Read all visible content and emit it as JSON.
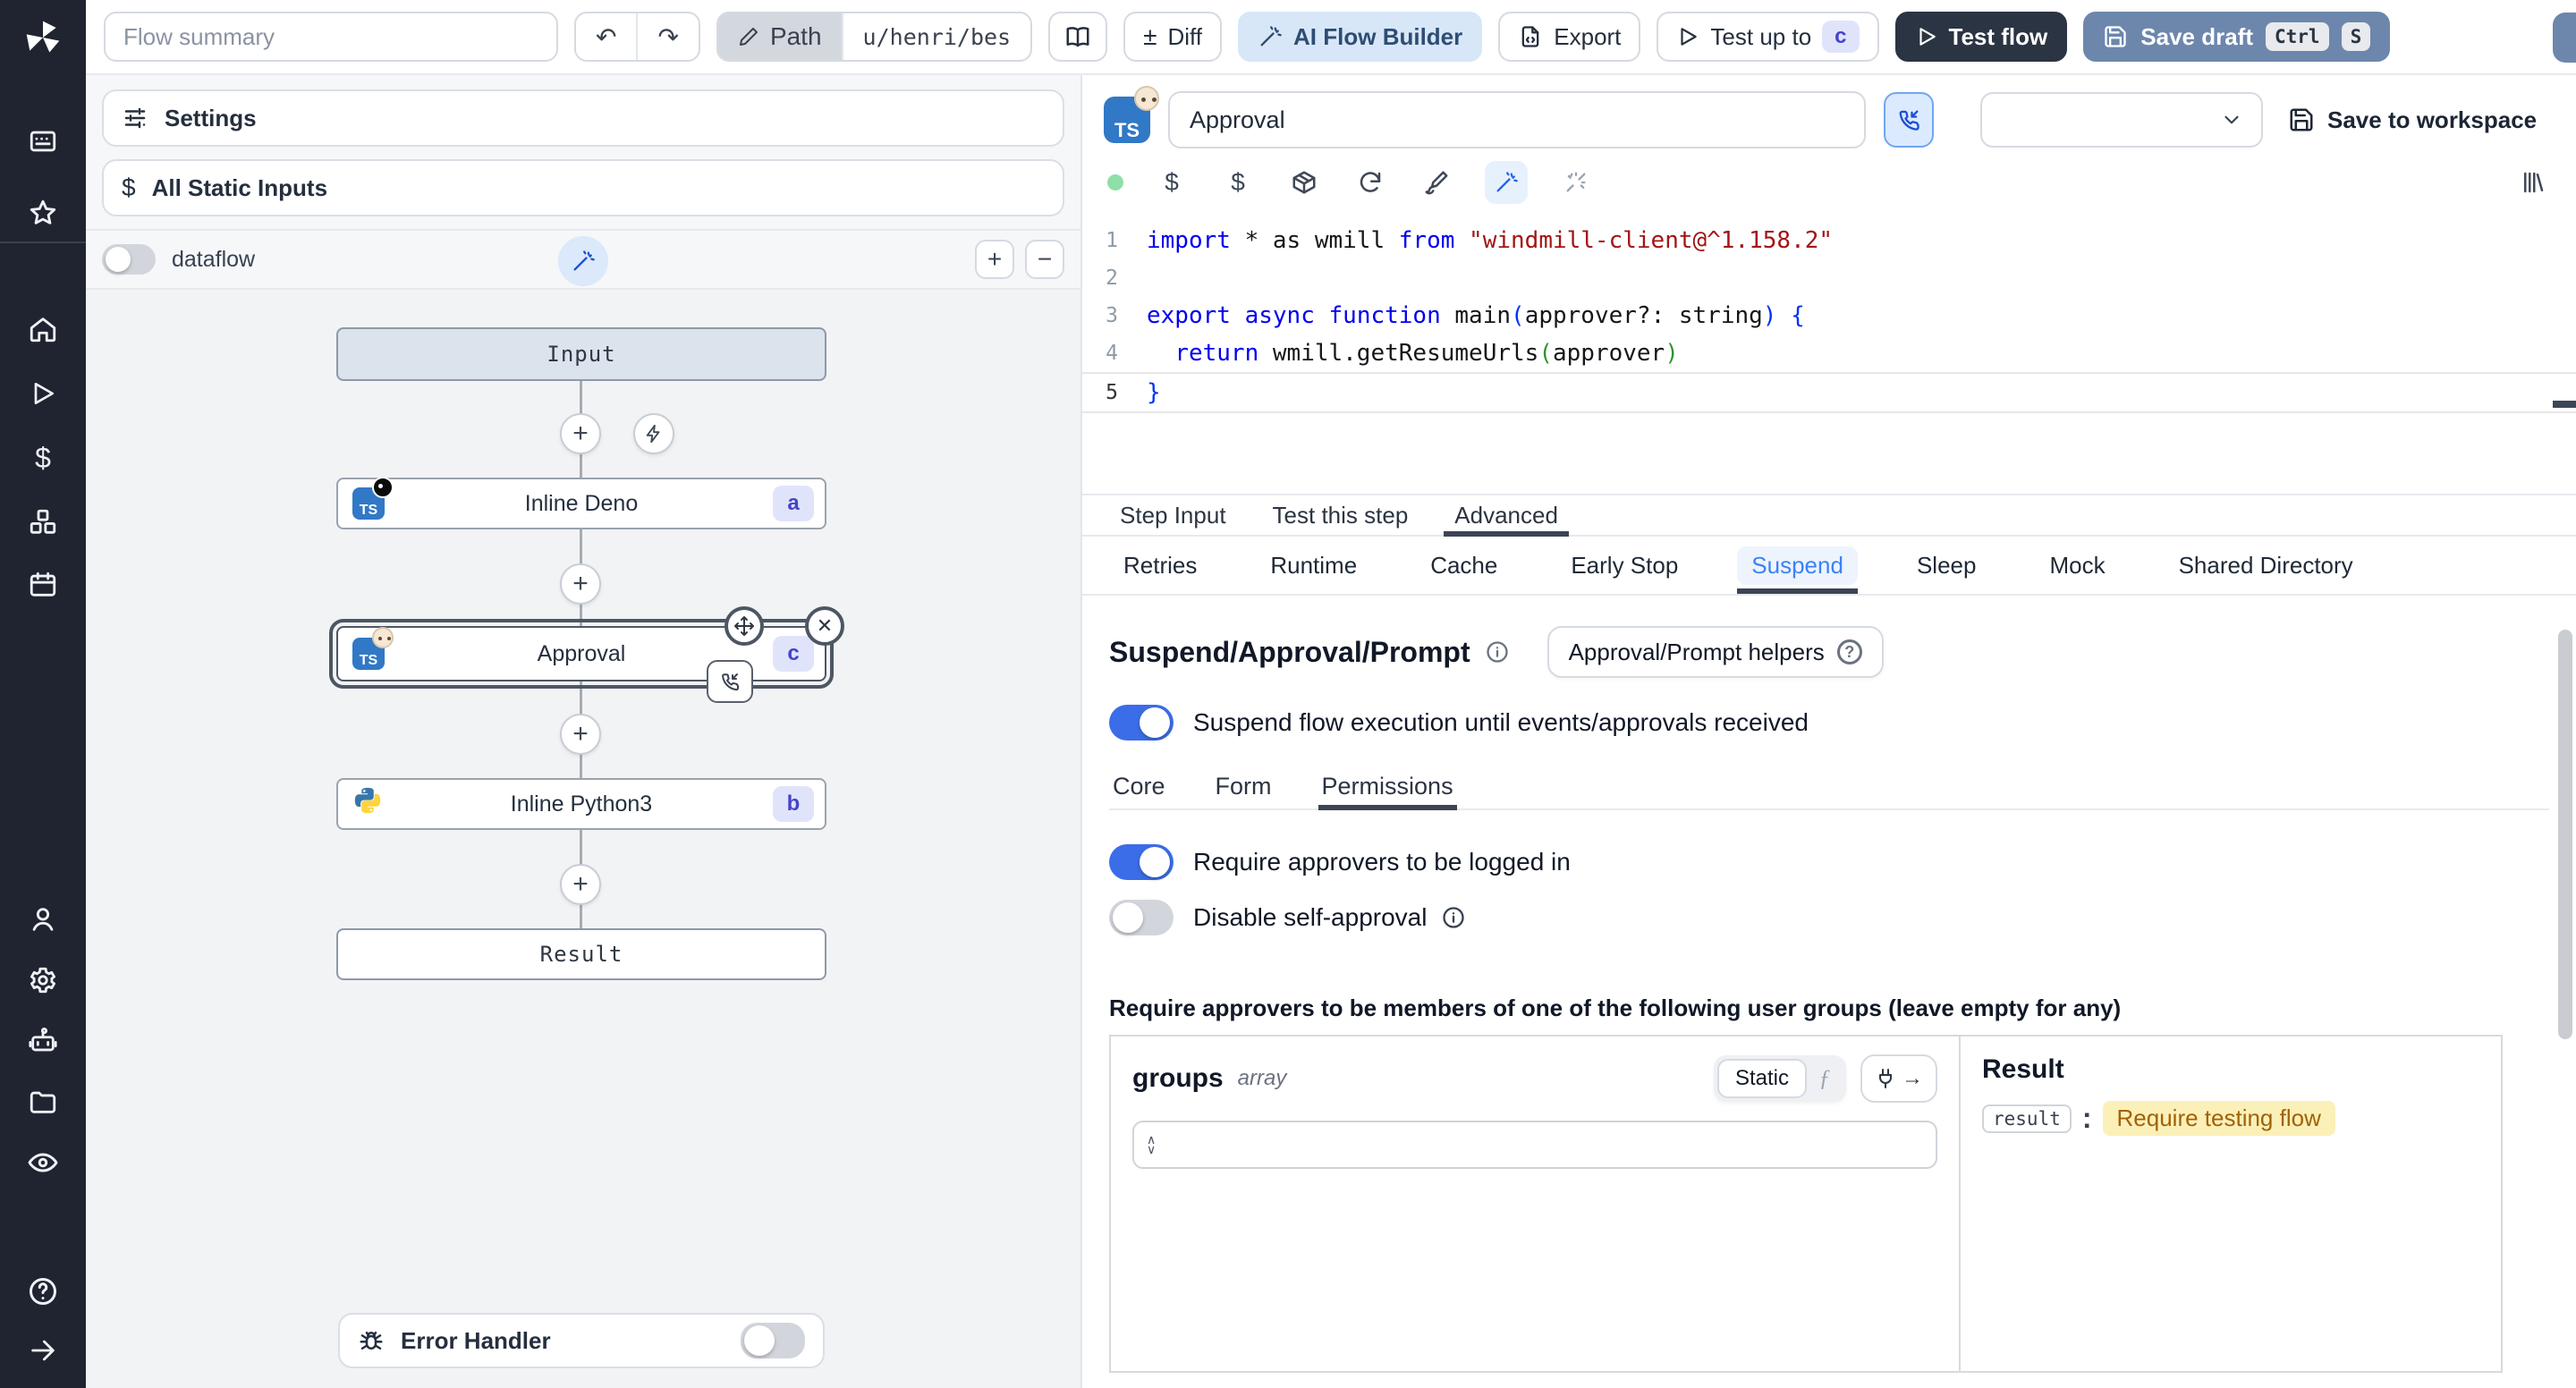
{
  "colors": {
    "accent_blue": "#3b6de8",
    "suspend_tab_blue": "#3b82f6",
    "ai_builder_bg": "#d7e7f8",
    "test_flow_bg": "#2b3442",
    "save_draft_bg": "#6d87ac",
    "step_badge_bg": "#e0e4fb",
    "step_badge_text": "#4444c8",
    "result_badge_bg": "#fbf0b8",
    "result_badge_text": "#a16207",
    "sidebar_bg": "#1f2430",
    "status_dot": "#8fdfa8"
  },
  "toolbar": {
    "flow_summary_placeholder": "Flow summary",
    "path_label": "Path",
    "path_value": "u/henri/bes",
    "diff_label": "Diff",
    "ai_flow_builder_label": "AI Flow Builder",
    "export_label": "Export",
    "test_up_to_label": "Test up to",
    "test_up_to_step": "c",
    "test_flow_label": "Test flow",
    "save_draft_label": "Save draft",
    "kbd_ctrl": "Ctrl",
    "kbd_s": "S"
  },
  "flow_panel": {
    "settings_label": "Settings",
    "static_inputs_label": "All Static Inputs",
    "dataflow_label": "dataflow",
    "zoom_in": "+",
    "zoom_out": "−",
    "error_handler_label": "Error Handler"
  },
  "graph": {
    "input_label": "Input",
    "result_label": "Result",
    "ts_label": "TS",
    "steps": [
      {
        "badge": "a",
        "label": "Inline Deno",
        "runtime": "deno"
      },
      {
        "badge": "c",
        "label": "Approval",
        "runtime": "bun",
        "selected": true
      },
      {
        "badge": "b",
        "label": "Inline Python3",
        "runtime": "python"
      }
    ]
  },
  "step_editor": {
    "name": "Approval",
    "save_to_workspace": "Save to workspace",
    "ts_label": "TS",
    "tabs": [
      {
        "label": "Step Input"
      },
      {
        "label": "Test this step"
      },
      {
        "label": "Advanced"
      }
    ],
    "active_tab": "Advanced",
    "subtabs": [
      {
        "label": "Retries"
      },
      {
        "label": "Runtime"
      },
      {
        "label": "Cache"
      },
      {
        "label": "Early Stop"
      },
      {
        "label": "Suspend"
      },
      {
        "label": "Sleep"
      },
      {
        "label": "Mock"
      },
      {
        "label": "Shared Directory"
      }
    ],
    "active_subtab": "Suspend",
    "code": {
      "lines": [
        [
          {
            "t": "import",
            "c": "k"
          },
          {
            "t": " * as wmill ",
            "c": "p"
          },
          {
            "t": "from",
            "c": "k"
          },
          {
            "t": " ",
            "c": "p"
          },
          {
            "t": "\"windmill-client@^1.158.2\"",
            "c": "s"
          }
        ],
        [],
        [
          {
            "t": "export",
            "c": "k"
          },
          {
            "t": " ",
            "c": "p"
          },
          {
            "t": "async",
            "c": "k"
          },
          {
            "t": " ",
            "c": "p"
          },
          {
            "t": "function",
            "c": "k"
          },
          {
            "t": " main",
            "c": "p"
          },
          {
            "t": "(",
            "c": "b1"
          },
          {
            "t": "approver?: string",
            "c": "p"
          },
          {
            "t": ")",
            "c": "b1"
          },
          {
            "t": " ",
            "c": "p"
          },
          {
            "t": "{",
            "c": "b1"
          }
        ],
        [
          {
            "t": "  ",
            "c": "p"
          },
          {
            "t": "return",
            "c": "k"
          },
          {
            "t": " wmill.getResumeUrls",
            "c": "p"
          },
          {
            "t": "(",
            "c": "b2"
          },
          {
            "t": "approver",
            "c": "p"
          },
          {
            "t": ")",
            "c": "b2"
          }
        ],
        [
          {
            "t": "}",
            "c": "b1"
          }
        ]
      ]
    }
  },
  "suspend": {
    "title": "Suspend/Approval/Prompt",
    "helpers_label": "Approval/Prompt helpers",
    "enable_label": "Suspend flow execution until events/approvals received",
    "tabs": [
      {
        "label": "Core"
      },
      {
        "label": "Form"
      },
      {
        "label": "Permissions"
      }
    ],
    "active_tab": "Permissions",
    "require_login_label": "Require approvers to be logged in",
    "disable_self_label": "Disable self-approval",
    "groups_note": "Require approvers to be members of one of the following user groups (leave empty for any)",
    "groups": {
      "name": "groups",
      "type_label": "array",
      "static_label": "Static"
    },
    "result": {
      "title": "Result",
      "key": "result",
      "value": "Require testing flow"
    }
  }
}
